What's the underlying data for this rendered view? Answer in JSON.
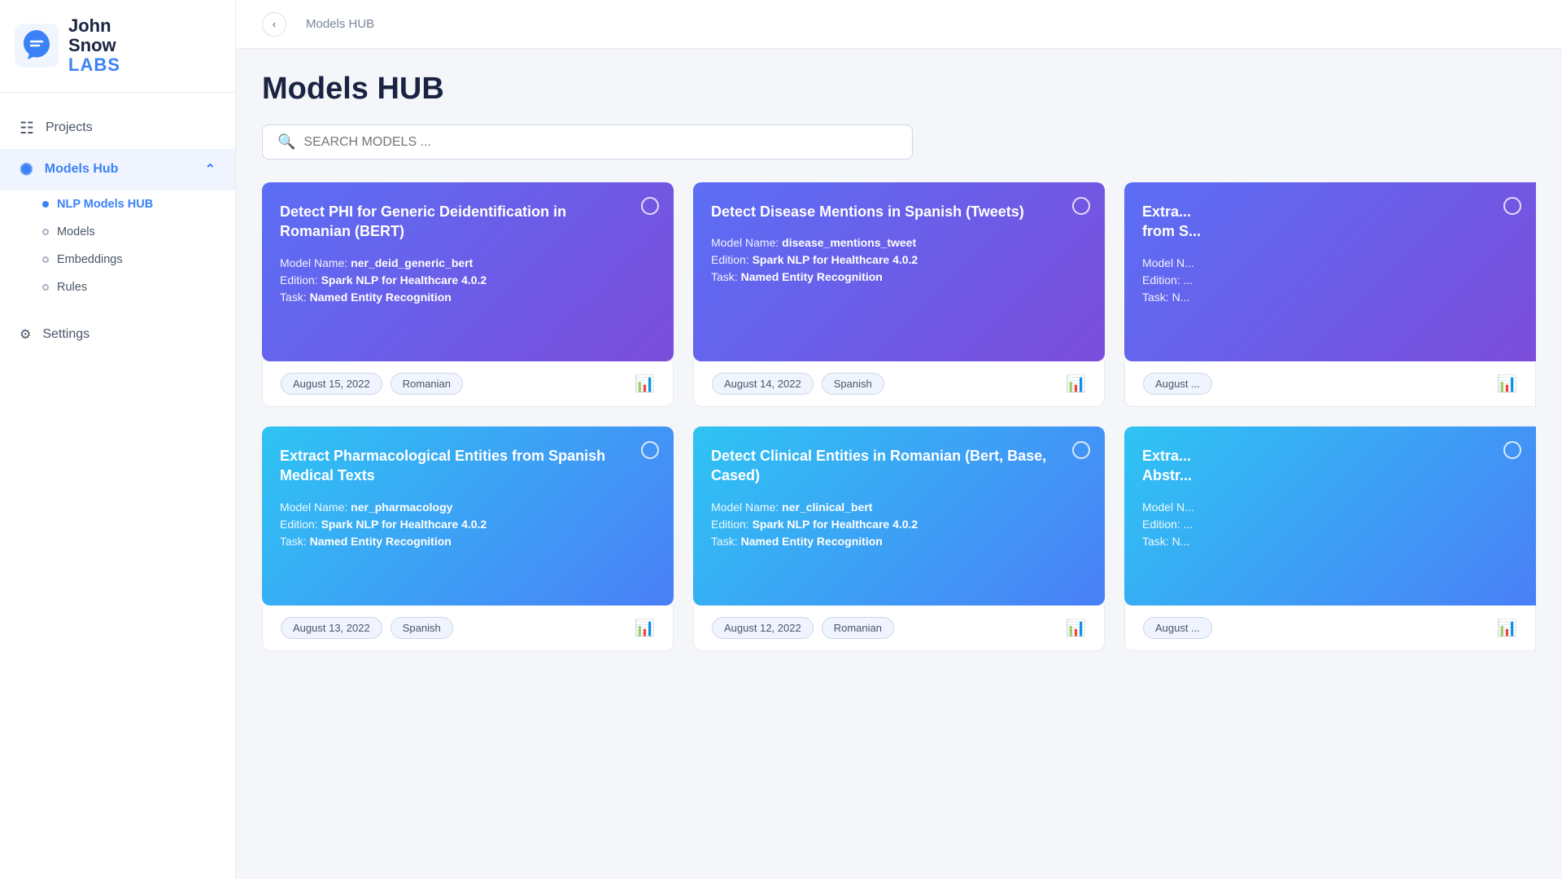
{
  "logo": {
    "john": "John",
    "snow": "Snow",
    "labs": "LABS"
  },
  "sidebar": {
    "projects_label": "Projects",
    "models_hub_label": "Models Hub",
    "sub_items": [
      {
        "label": "NLP Models HUB",
        "active": true
      },
      {
        "label": "Models",
        "active": false
      },
      {
        "label": "Embeddings",
        "active": false
      },
      {
        "label": "Rules",
        "active": false
      }
    ],
    "settings_label": "Settings"
  },
  "topbar": {
    "breadcrumb": "Models HUB"
  },
  "main": {
    "title": "Models HUB",
    "search_placeholder": "SEARCH MODELS ..."
  },
  "cards": [
    {
      "id": 1,
      "title": "Detect PHI for Generic Deidentification in Romanian (BERT)",
      "model_name": "ner_deid_generic_bert",
      "edition": "Spark NLP for Healthcare 4.0.2",
      "task": "Named Entity Recognition",
      "date": "August 15, 2022",
      "language": "Romanian",
      "style": "blue-purple"
    },
    {
      "id": 2,
      "title": "Detect Disease Mentions in Spanish (Tweets)",
      "model_name": "disease_mentions_tweet",
      "edition": "Spark NLP for Healthcare 4.0.2",
      "task": "Named Entity Recognition",
      "date": "August 14, 2022",
      "language": "Spanish",
      "style": "blue-purple"
    },
    {
      "id": 3,
      "title": "Extra... from S...",
      "model_name": "Model N...",
      "edition": "Edition: ...",
      "task": "Task: N...",
      "date": "August ...",
      "language": "",
      "style": "blue-purple",
      "partial": true
    },
    {
      "id": 4,
      "title": "Extract Pharmacological Entities from Spanish Medical Texts",
      "model_name": "ner_pharmacology",
      "edition": "Spark NLP for Healthcare 4.0.2",
      "task": "Named Entity Recognition",
      "date": "August 13, 2022",
      "language": "Spanish",
      "style": "teal-blue"
    },
    {
      "id": 5,
      "title": "Detect Clinical Entities in Romanian (Bert, Base, Cased)",
      "model_name": "ner_clinical_bert",
      "edition": "Spark NLP for Healthcare 4.0.2",
      "task": "Named Entity Recognition",
      "date": "August 12, 2022",
      "language": "Romanian",
      "style": "teal-blue"
    },
    {
      "id": 6,
      "title": "Extra... Abstr...",
      "model_name": "Model N...",
      "edition": "Edition: ...",
      "task": "Task: N...",
      "date": "August ...",
      "language": "",
      "style": "teal-blue",
      "partial": true
    }
  ],
  "labels": {
    "model_name": "Model Name: ",
    "edition": "Edition: ",
    "task": "Task: "
  }
}
